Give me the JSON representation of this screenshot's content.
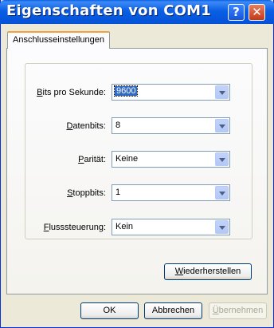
{
  "window": {
    "title": "Eigenschaften von COM1"
  },
  "titlebar": {
    "help_glyph": "?",
    "close_glyph": "✕"
  },
  "tabs": [
    {
      "label": "Anschlusseinstellungen",
      "selected": true
    }
  ],
  "fields": [
    {
      "label_pre": "",
      "label_key": "B",
      "label_post": "its pro Sekunde:",
      "value": "9600",
      "focused": true
    },
    {
      "label_pre": "",
      "label_key": "D",
      "label_post": "atenbits:",
      "value": "8",
      "focused": false
    },
    {
      "label_pre": "",
      "label_key": "P",
      "label_post": "arität:",
      "value": "Keine",
      "focused": false
    },
    {
      "label_pre": "",
      "label_key": "S",
      "label_post": "toppbits:",
      "value": "1",
      "focused": false
    },
    {
      "label_pre": "",
      "label_key": "F",
      "label_post": "lusssteuerung:",
      "value": "Kein",
      "focused": false
    }
  ],
  "restore_button": {
    "key": "W",
    "rest": "iederherstellen"
  },
  "footer": {
    "ok": "OK",
    "cancel": "Abbrechen",
    "apply_key": "Ü",
    "apply_rest": "bernehmen",
    "apply_enabled": false
  },
  "colors": {
    "titlebar": "#0a5fe4",
    "dialog_bg": "#ece9d8",
    "tab_accent": "#f0a33a",
    "selection": "#316ac5"
  }
}
